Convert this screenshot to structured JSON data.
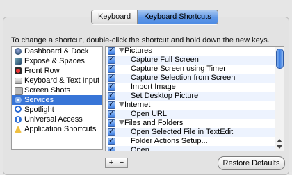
{
  "tabs": [
    {
      "label": "Keyboard",
      "active": false
    },
    {
      "label": "Keyboard Shortcuts",
      "active": true
    }
  ],
  "instructions": "To change a shortcut, double-click the shortcut and hold down the new keys.",
  "categories": [
    {
      "label": "Dashboard & Dock",
      "icon": "dashboard-icon"
    },
    {
      "label": "Exposé & Spaces",
      "icon": "expose-icon"
    },
    {
      "label": "Front Row",
      "icon": "front-row-icon"
    },
    {
      "label": "Keyboard & Text Input",
      "icon": "keyboard-icon"
    },
    {
      "label": "Screen Shots",
      "icon": "screenshot-icon"
    },
    {
      "label": "Services",
      "icon": "services-icon",
      "selected": true
    },
    {
      "label": "Spotlight",
      "icon": "spotlight-icon"
    },
    {
      "label": "Universal Access",
      "icon": "universal-access-icon"
    },
    {
      "label": "Application Shortcuts",
      "icon": "app-shortcuts-icon"
    }
  ],
  "shortcuts": [
    {
      "label": "Pictures",
      "group": true,
      "checked": true
    },
    {
      "label": "Capture Full Screen",
      "group": false,
      "checked": true
    },
    {
      "label": "Capture Screen using Timer",
      "group": false,
      "checked": true
    },
    {
      "label": "Capture Selection from Screen",
      "group": false,
      "checked": true
    },
    {
      "label": "Import Image",
      "group": false,
      "checked": true
    },
    {
      "label": "Set Desktop Picture",
      "group": false,
      "checked": true
    },
    {
      "label": "Internet",
      "group": true,
      "checked": true
    },
    {
      "label": "Open URL",
      "group": false,
      "checked": true
    },
    {
      "label": "Files and Folders",
      "group": true,
      "checked": true
    },
    {
      "label": "Open Selected File in TextEdit",
      "group": false,
      "checked": true
    },
    {
      "label": "Folder Actions Setup...",
      "group": false,
      "checked": true
    },
    {
      "label": "Open",
      "group": false,
      "checked": true
    }
  ],
  "buttons": {
    "plus": "+",
    "minus": "−",
    "restore": "Restore Defaults"
  }
}
